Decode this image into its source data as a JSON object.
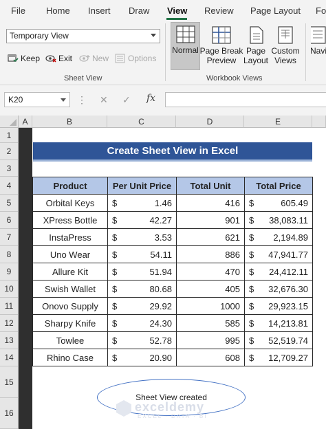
{
  "ribbon": {
    "tabs": [
      "File",
      "Home",
      "Insert",
      "Draw",
      "View",
      "Review",
      "Page Layout",
      "Fo"
    ],
    "active_tab": "View",
    "sheet_view": {
      "selected_view": "Temporary View",
      "keep_label": "Keep",
      "exit_label": "Exit",
      "new_label": "New",
      "options_label": "Options",
      "group_label": "Sheet View"
    },
    "workbook_views": {
      "normal_label": "Normal",
      "page_break_label_1": "Page Break",
      "page_break_label_2": "Preview",
      "page_layout_label_1": "Page",
      "page_layout_label_2": "Layout",
      "custom_views_label_1": "Custom",
      "custom_views_label_2": "Views",
      "navigation_label": "Navi",
      "group_label": "Workbook Views"
    }
  },
  "formula_bar": {
    "name_box": "K20",
    "cancel_icon": "✕",
    "enter_icon": "✓",
    "fx_label": "fx",
    "formula": ""
  },
  "grid": {
    "columns": [
      "A",
      "B",
      "C",
      "D",
      "E"
    ],
    "rows": [
      "1",
      "2",
      "3",
      "4",
      "5",
      "6",
      "7",
      "8",
      "9",
      "10",
      "11",
      "12",
      "13",
      "14",
      "15",
      "16"
    ]
  },
  "sheet": {
    "title": "Create Sheet View in Excel",
    "headers": [
      "Product",
      "Per Unit Price",
      "Total Unit",
      "Total Price"
    ],
    "currency_symbol": "$",
    "rows": [
      [
        "Orbital Keys",
        "1.46",
        "416",
        "605.49"
      ],
      [
        "XPress Bottle",
        "42.27",
        "901",
        "38,083.11"
      ],
      [
        "InstaPress",
        "3.53",
        "621",
        "2,194.89"
      ],
      [
        "Uno Wear",
        "54.11",
        "886",
        "47,941.77"
      ],
      [
        "Allure Kit",
        "51.94",
        "470",
        "24,412.11"
      ],
      [
        "Swish Wallet",
        "80.68",
        "405",
        "32,676.30"
      ],
      [
        "Onovo Supply",
        "29.92",
        "1000",
        "29,923.15"
      ],
      [
        "Sharpy Knife",
        "24.30",
        "585",
        "14,213.81"
      ],
      [
        "Towlee",
        "52.78",
        "995",
        "52,519.74"
      ],
      [
        "Rhino Case",
        "20.90",
        "608",
        "12,709.27"
      ]
    ],
    "callout": "Sheet View created"
  },
  "watermark": {
    "name": "exceldemy",
    "tagline": "EXCEL · DATA · BI"
  },
  "colors": {
    "title_fill": "#2f5597",
    "header_fill": "#b4c7e7",
    "accent": "#217346",
    "oval_border": "#4472c4"
  }
}
